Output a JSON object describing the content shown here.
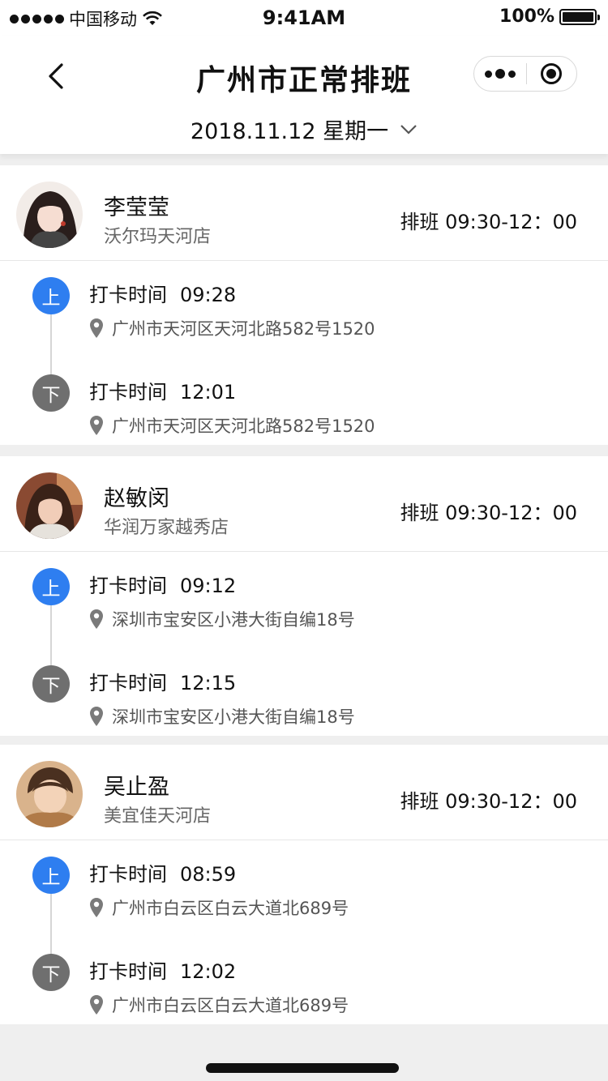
{
  "status_bar": {
    "carrier": "中国移动",
    "time": "9:41AM",
    "battery": "100%"
  },
  "header": {
    "title": "广州市正常排班",
    "date": "2018.11.12 星期一"
  },
  "records": [
    {
      "name": "李莹莹",
      "store": "沃尔玛天河店",
      "shift": "排班 09:30-12：00",
      "on": {
        "badge": "上",
        "label": "打卡时间",
        "time": "09:28",
        "location": "广州市天河区天河北路582号1520"
      },
      "off": {
        "badge": "下",
        "label": "打卡时间",
        "time": "12:01",
        "location": "广州市天河区天河北路582号1520"
      }
    },
    {
      "name": "赵敏闵",
      "store": "华润万家越秀店",
      "shift": "排班 09:30-12：00",
      "on": {
        "badge": "上",
        "label": "打卡时间",
        "time": "09:12",
        "location": "深圳市宝安区小港大街自编18号"
      },
      "off": {
        "badge": "下",
        "label": "打卡时间",
        "time": "12:15",
        "location": "深圳市宝安区小港大街自编18号"
      }
    },
    {
      "name": "吴止盈",
      "store": "美宜佳天河店",
      "shift": "排班 09:30-12：00",
      "on": {
        "badge": "上",
        "label": "打卡时间",
        "time": "08:59",
        "location": "广州市白云区白云大道北689号"
      },
      "off": {
        "badge": "下",
        "label": "打卡时间",
        "time": "12:02",
        "location": "广州市白云区白云大道北689号"
      }
    }
  ],
  "colors": {
    "on_badge": "#2e7ef0",
    "off_badge": "#6f6f6f",
    "page_bg": "#efefef"
  }
}
